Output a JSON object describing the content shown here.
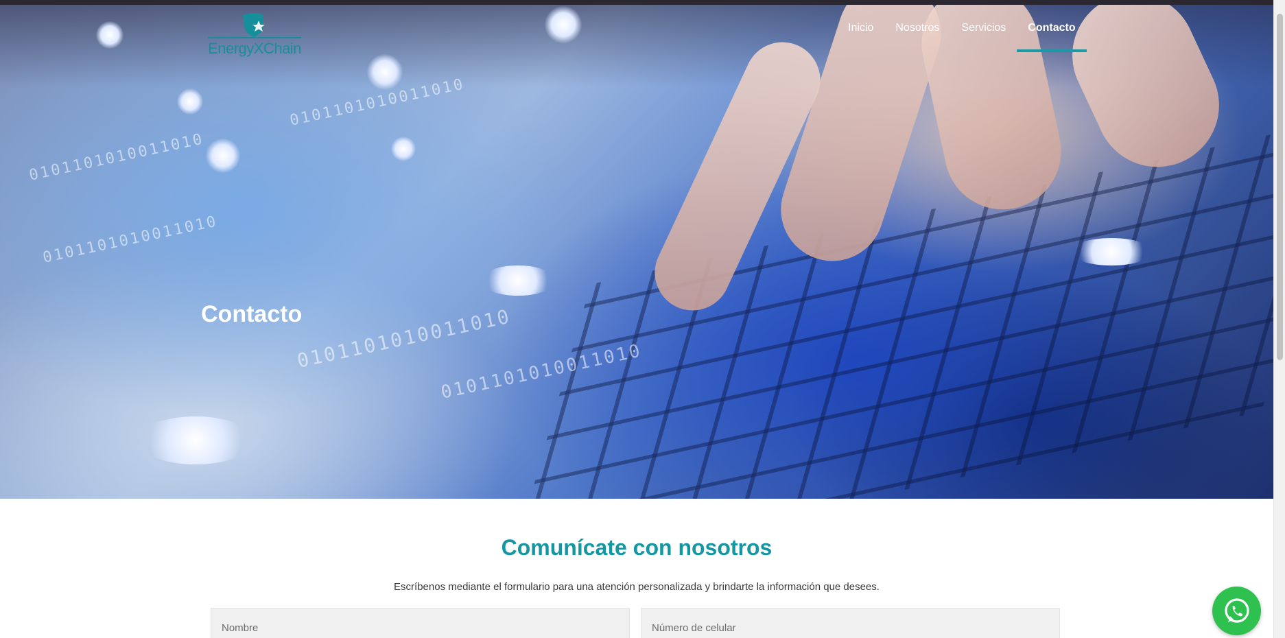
{
  "brand": {
    "name": "EnergyXChain",
    "color": "#168f9c"
  },
  "nav": {
    "items": [
      {
        "label": "Inicio",
        "active": false
      },
      {
        "label": "Nosotros",
        "active": false
      },
      {
        "label": "Servicios",
        "active": false
      },
      {
        "label": "Contacto",
        "active": true
      }
    ],
    "active_color": "#1a9aa6"
  },
  "hero": {
    "title": "Contacto",
    "binary_text": "0101101010011010"
  },
  "contact": {
    "title": "Comunícate con nosotros",
    "description": "Escríbenos mediante el formulario para una atención personalizada y brindarte la información que desees.",
    "fields": {
      "name_placeholder": "Nombre",
      "phone_placeholder": "Número de celular"
    }
  },
  "whatsapp": {
    "icon": "whatsapp-icon",
    "color": "#2fc14f"
  }
}
